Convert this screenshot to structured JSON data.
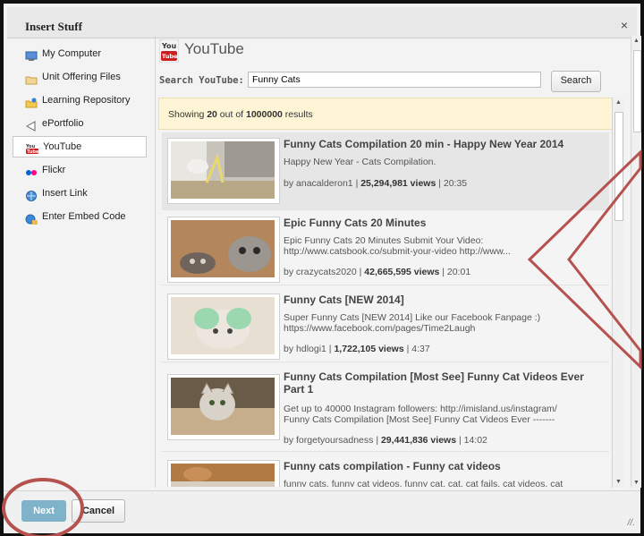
{
  "dialog": {
    "title": "Insert Stuff",
    "close": "×"
  },
  "sidebar": {
    "items": [
      {
        "label": "My Computer",
        "icon": "computer-icon"
      },
      {
        "label": "Unit Offering Files",
        "icon": "folder-icon"
      },
      {
        "label": "Learning Repository",
        "icon": "repository-icon"
      },
      {
        "label": "ePortfolio",
        "icon": "eportfolio-icon"
      },
      {
        "label": "YouTube",
        "icon": "youtube-icon",
        "active": true
      },
      {
        "label": "Flickr",
        "icon": "flickr-icon"
      },
      {
        "label": "Insert Link",
        "icon": "link-globe-icon"
      },
      {
        "label": "Enter Embed Code",
        "icon": "embed-globe-icon"
      }
    ]
  },
  "main": {
    "heading": "YouTube",
    "logo_top": "You",
    "logo_bottom": "Tube",
    "search_label": "Search YouTube:",
    "search_value": "Funny Cats",
    "search_button": "Search",
    "notice_prefix": "Showing ",
    "notice_shown": "20",
    "notice_middle": " out of ",
    "notice_total": "1000000",
    "notice_suffix": " results"
  },
  "results": [
    {
      "title": "Funny Cats Compilation 20 min - Happy New Year 2014",
      "desc1": "Happy New Year - Cats Compilation.",
      "desc2": "",
      "author": "anacalderon1",
      "views": "25,294,981 views",
      "duration": "20:35"
    },
    {
      "title": "Epic Funny Cats 20 Minutes",
      "desc1": "Epic Funny Cats 20 Minutes Submit Your Video:",
      "desc2": "http://www.catsbook.co/submit-your-video http://www...",
      "author": "crazycats2020",
      "views": "42,665,595 views",
      "duration": "20:01"
    },
    {
      "title": "Funny Cats [NEW 2014]",
      "desc1": "Super Funny Cats [NEW 2014] Like our Facebook Fanpage :)",
      "desc2": "https://www.facebook.com/pages/Time2Laugh",
      "author": "hdlogi1",
      "views": "1,722,105 views",
      "duration": "4:37"
    },
    {
      "title": "Funny Cats Compilation [Most See] Funny Cat Videos Ever Part 1",
      "desc1": "Get up to 40000 Instagram followers: http://imisland.us/instagram/",
      "desc2": "Funny Cats Compilation [Most See] Funny Cat Videos Ever -------",
      "author": "forgetyoursadness",
      "views": "29,441,836 views",
      "duration": "14:02"
    },
    {
      "title": "Funny cats compilation - Funny cat videos",
      "desc1": "funny cats, funny cat videos, funny cat, cat, cat fails, cat videos, cat",
      "desc2": "",
      "author": "",
      "views": "",
      "duration": ""
    }
  ],
  "meta_separator": " | ",
  "meta_prefix": "by ",
  "footer": {
    "next": "Next",
    "cancel": "Cancel",
    "grip": "//."
  },
  "colors": {
    "annotation": "#b5524f",
    "next_button": "#7fb3c9",
    "notice_bg": "#fdf5d6"
  }
}
